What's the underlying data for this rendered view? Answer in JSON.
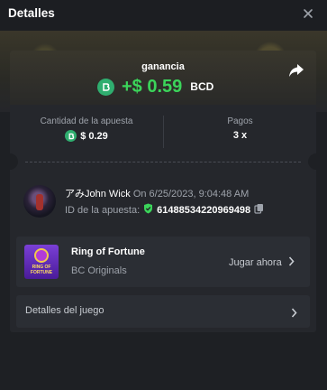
{
  "modal": {
    "title": "Detalles"
  },
  "win": {
    "label": "ganancia",
    "amount": "+$ 0.59",
    "currency": "BCD"
  },
  "stats": {
    "bet_label": "Cantidad de la apuesta",
    "bet_value": "$ 0.29",
    "payout_label": "Pagos",
    "payout_value": "3 x"
  },
  "user": {
    "name": "アみJohn Wick",
    "datetime": "On 6/25/2023, 9:04:48 AM",
    "bet_id_label": "ID de la apuesta:",
    "bet_id": "614885342209694​98"
  },
  "game": {
    "name": "Ring of Fortune",
    "provider": "BC Originals",
    "play_label": "Jugar ahora",
    "thumb_text": "RING OF FORTUNE"
  },
  "game_details": {
    "label": "Detalles del juego"
  },
  "colors": {
    "accent_green": "#3bd45a",
    "coin": "#2fae6f",
    "background": "#1e2024"
  }
}
